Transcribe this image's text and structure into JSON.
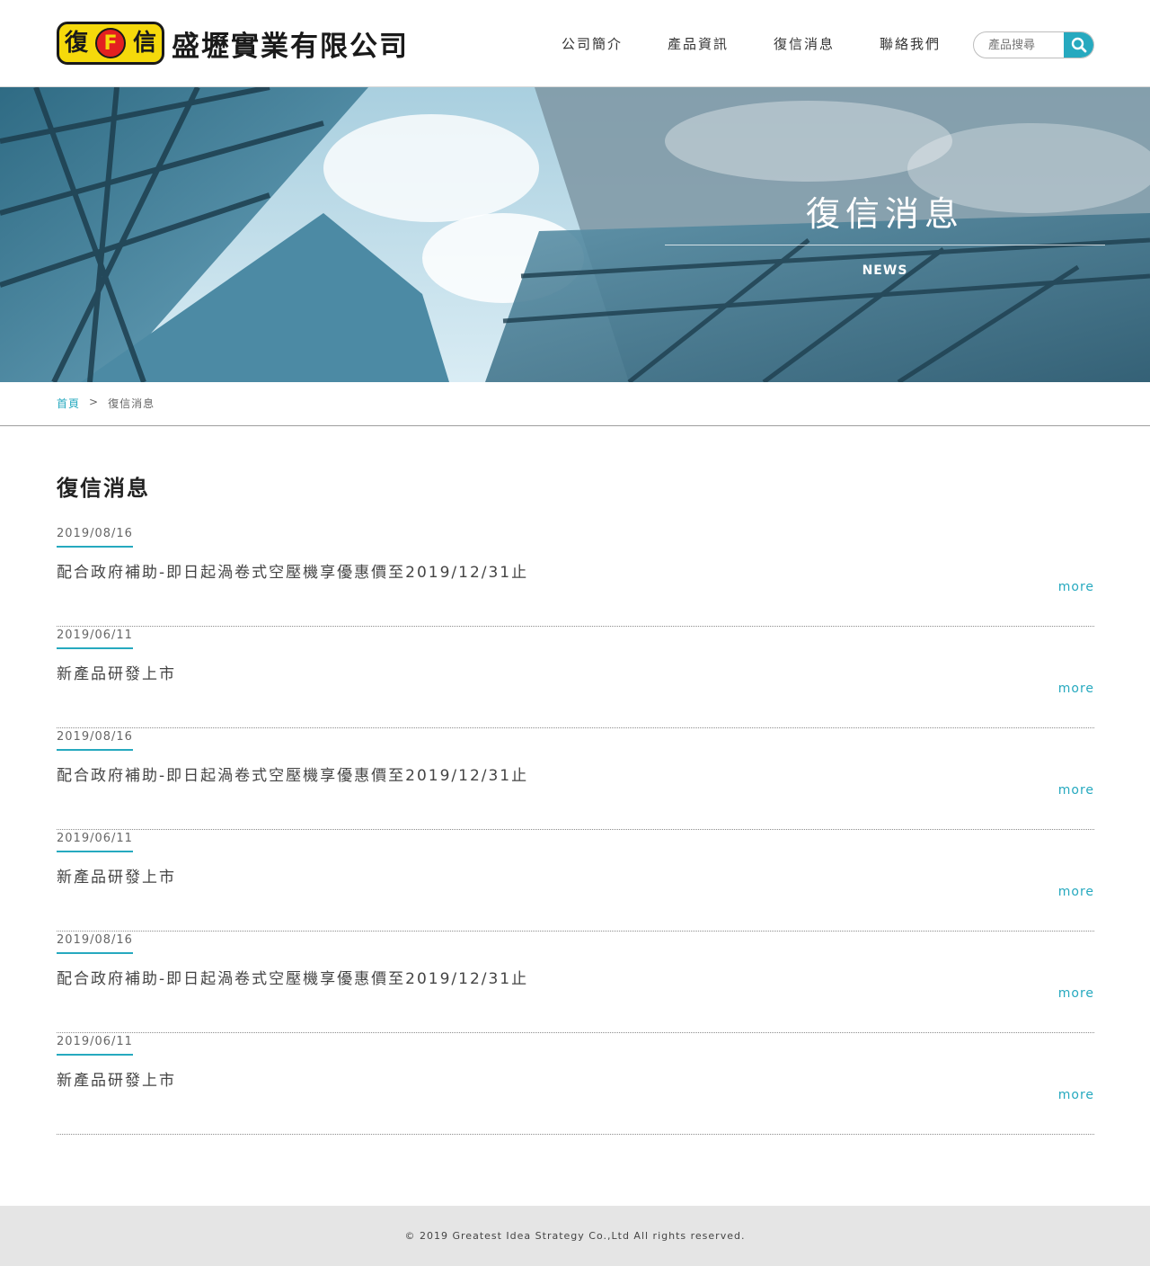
{
  "header": {
    "logo_left_char": "復",
    "logo_center_char": "F",
    "logo_right_char": "信",
    "company_name": "盛壢實業有限公司",
    "nav": [
      "公司簡介",
      "產品資訊",
      "復信消息",
      "聯絡我們"
    ],
    "search_placeholder": "產品搜尋"
  },
  "banner": {
    "title": "復信消息",
    "subtitle": "NEWS"
  },
  "breadcrumb": {
    "home": "首頁",
    "separator": ">",
    "current": "復信消息"
  },
  "main": {
    "title": "復信消息",
    "more_label": "more",
    "items": [
      {
        "date": "2019/08/16",
        "title": "配合政府補助-即日起渦卷式空壓機享優惠價至2019/12/31止"
      },
      {
        "date": "2019/06/11",
        "title": "新產品研發上市"
      },
      {
        "date": "2019/08/16",
        "title": "配合政府補助-即日起渦卷式空壓機享優惠價至2019/12/31止"
      },
      {
        "date": "2019/06/11",
        "title": "新產品研發上市"
      },
      {
        "date": "2019/08/16",
        "title": "配合政府補助-即日起渦卷式空壓機享優惠價至2019/12/31止"
      },
      {
        "date": "2019/06/11",
        "title": "新產品研發上市"
      }
    ]
  },
  "footer": {
    "copyright": "© 2019 Greatest Idea Strategy Co.,Ltd All rights reserved."
  },
  "colors": {
    "accent": "#26a9bf",
    "footer_bg": "#e5e5e5"
  }
}
